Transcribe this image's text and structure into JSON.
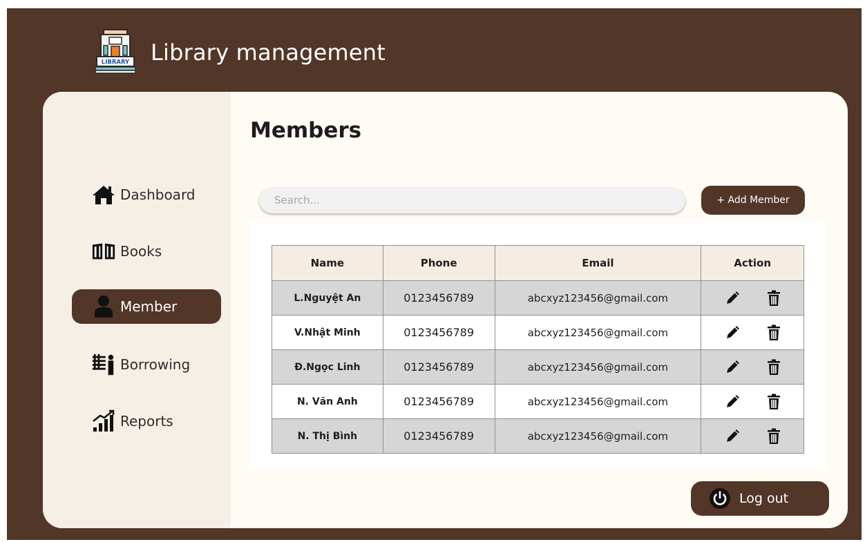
{
  "app": {
    "logo_text": "LIBRARY",
    "title": "Library management"
  },
  "sidebar": {
    "items": [
      {
        "label": "Dashboard",
        "icon": "home-icon",
        "active": false
      },
      {
        "label": "Books",
        "icon": "book-icon",
        "active": false
      },
      {
        "label": "Member",
        "icon": "user-icon",
        "active": true
      },
      {
        "label": "Borrowing",
        "icon": "borrowing-icon",
        "active": false
      },
      {
        "label": "Reports",
        "icon": "chart-icon",
        "active": false
      }
    ]
  },
  "main": {
    "title": "Members",
    "search_placeholder": "Search...",
    "add_button": "+ Add Member",
    "logout_button": "Log out"
  },
  "table": {
    "columns": [
      "Name",
      "Phone",
      "Email",
      "Action"
    ],
    "rows": [
      {
        "name": "L.Nguyệt An",
        "phone": "0123456789",
        "email": "abcxyz123456@gmail.com"
      },
      {
        "name": "V.Nhật Minh",
        "phone": "0123456789",
        "email": "abcxyz123456@gmail.com"
      },
      {
        "name": "Đ.Ngọc Linh",
        "phone": "0123456789",
        "email": "abcxyz123456@gmail.com"
      },
      {
        "name": "N. Văn Anh",
        "phone": "0123456789",
        "email": "abcxyz123456@gmail.com"
      },
      {
        "name": "N. Thị Bình",
        "phone": "0123456789",
        "email": "abcxyz123456@gmail.com"
      }
    ]
  },
  "colors": {
    "brand": "#523628",
    "sidebar_bg": "#f5efe6",
    "content_bg": "#fffcf6",
    "row_shaded": "#d6d6d6",
    "header_bg": "#f5ede2"
  }
}
